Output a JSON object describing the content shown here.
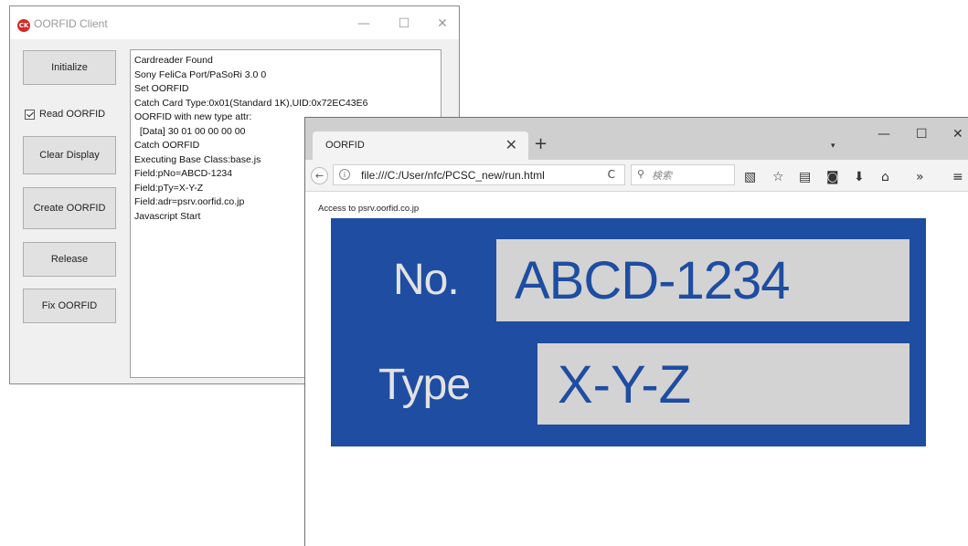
{
  "client": {
    "title": "OORFID Client",
    "icon": "app-logo-icon",
    "icon_text": "CK",
    "window_controls": {
      "minimize": "—",
      "maximize": "☐",
      "close": "✕"
    },
    "buttons": {
      "initialize": "Initialize",
      "clear_display": "Clear Display",
      "create_oorfid": "Create OORFID",
      "release": "Release",
      "fix_oorfid": "Fix OORFID"
    },
    "checkbox": {
      "label": "Read OORFID",
      "checked": true
    },
    "log_lines": [
      "Cardreader Found",
      "Sony FeliCa Port/PaSoRi 3.0 0",
      "Set OORFID",
      "Catch Card Type:0x01(Standard 1K),UID:0x72EC43E6",
      "OORFID with new type attr:",
      "  [Data] 30 01 00 00 00 00",
      "Catch OORFID",
      "Executing Base Class:base.js",
      "Field:pNo=ABCD-1234",
      "Field:pTy=X-Y-Z",
      "Field:adr=psrv.oorfid.co.jp",
      "Javascript Start"
    ]
  },
  "browser": {
    "tab": {
      "title": "OORFID",
      "close": "✕"
    },
    "new_tab": "+",
    "tab_list_arrow": "▾",
    "window_controls": {
      "minimize": "—",
      "maximize": "☐",
      "close": "✕"
    },
    "navbar": {
      "back": "←",
      "info": "i",
      "url": "file:///C:/User/nfc/PCSC_new/run.html",
      "reload": "C",
      "search_icon": "⚲",
      "search_placeholder": "検索",
      "toolbar_icons": {
        "reader": "▧",
        "bookmark": "☆",
        "library": "▤",
        "pocket": "◙",
        "downloads": "⬇",
        "home": "⌂",
        "overflow": "»",
        "menu": "≡"
      }
    },
    "page": {
      "access_text": "Access to psrv.oorfid.co.jp",
      "no_label": "No.",
      "no_value": "ABCD-1234",
      "type_label": "Type",
      "type_value": "X-Y-Z"
    }
  },
  "colors": {
    "panel_blue": "#1e4da1",
    "value_box_gray": "#d3d3d3",
    "app_icon_red": "#d42a2a"
  }
}
